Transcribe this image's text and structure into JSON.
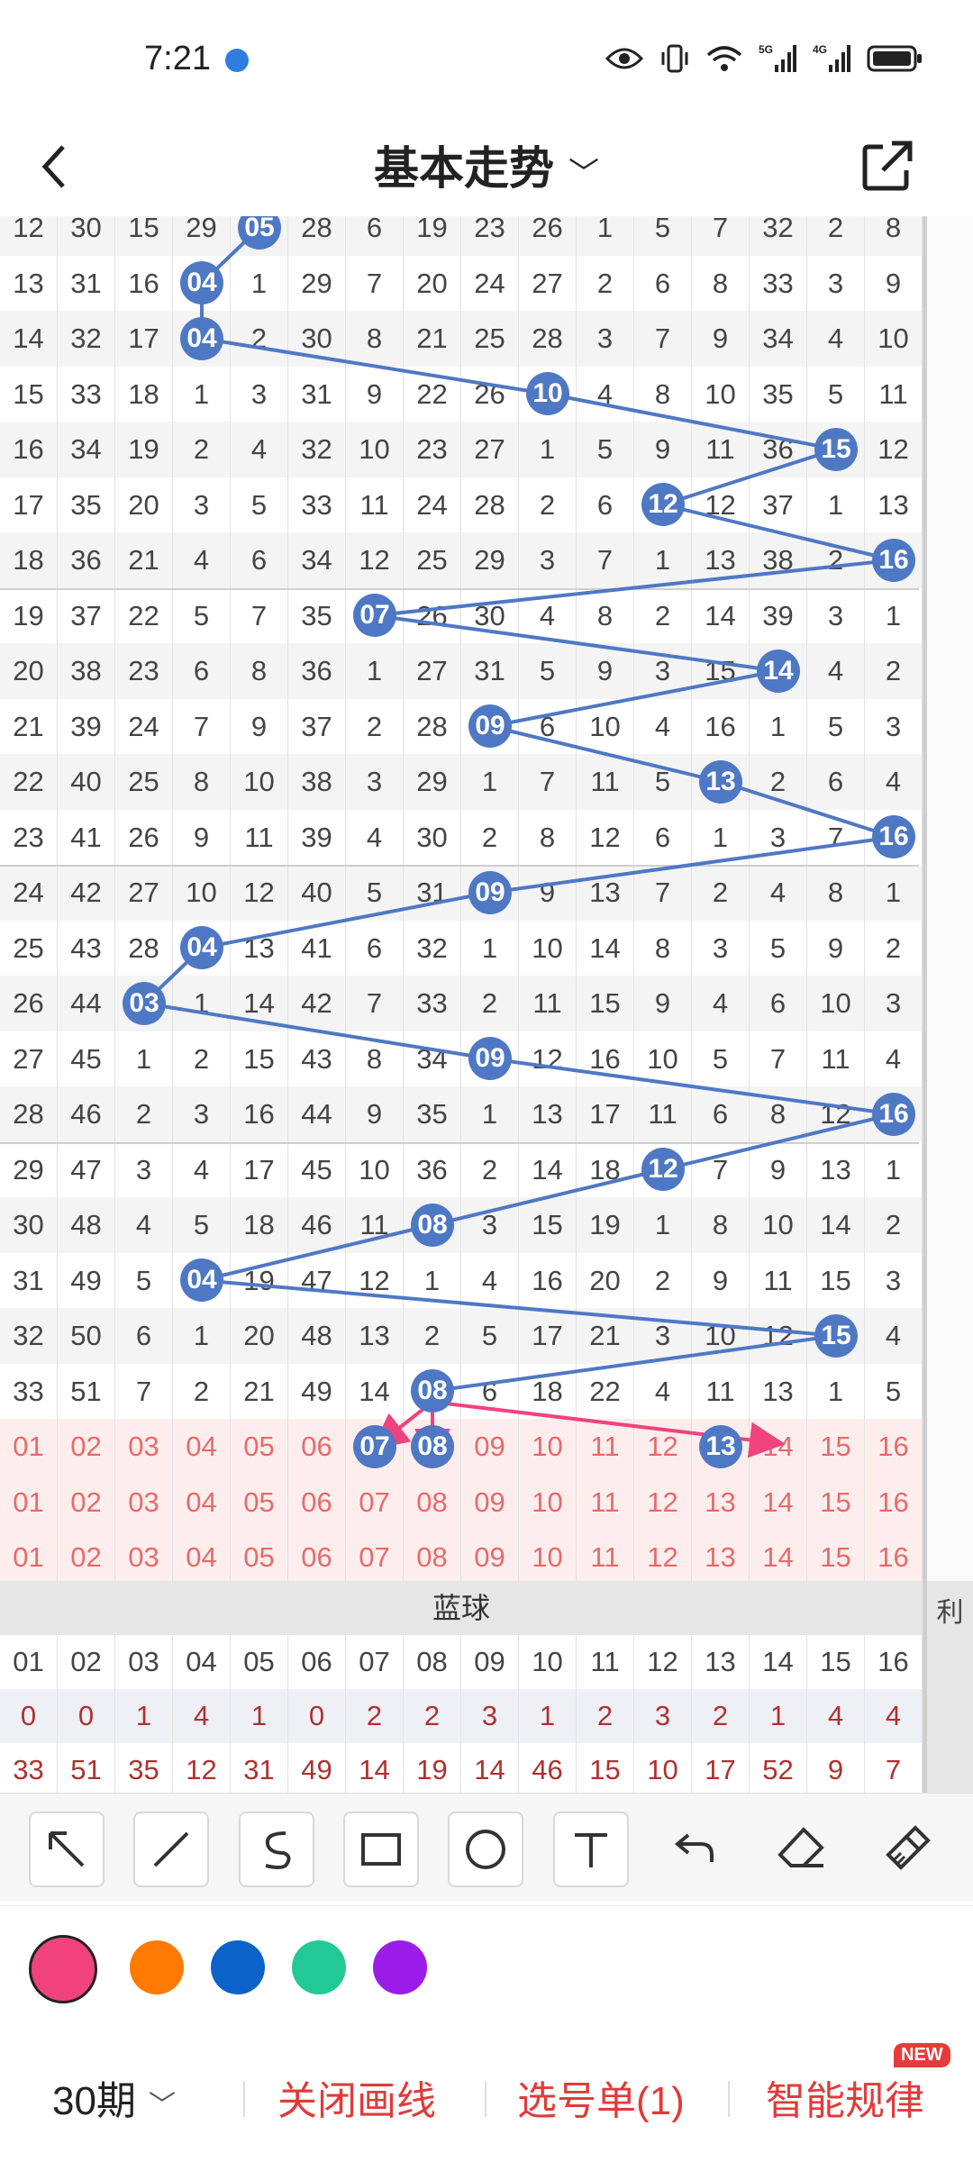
{
  "status": {
    "time": "7:21"
  },
  "header": {
    "title": "基本走势"
  },
  "grid": {
    "rows": [
      [
        "12",
        "30",
        "15",
        "29",
        "05",
        "28",
        "6",
        "19",
        "23",
        "26",
        "1",
        "5",
        "7",
        "32",
        "2",
        "8"
      ],
      [
        "13",
        "31",
        "16",
        "04",
        "1",
        "29",
        "7",
        "20",
        "24",
        "27",
        "2",
        "6",
        "8",
        "33",
        "3",
        "9"
      ],
      [
        "14",
        "32",
        "17",
        "04",
        "2",
        "30",
        "8",
        "21",
        "25",
        "28",
        "3",
        "7",
        "9",
        "34",
        "4",
        "10"
      ],
      [
        "15",
        "33",
        "18",
        "1",
        "3",
        "31",
        "9",
        "22",
        "26",
        "10",
        "4",
        "8",
        "10",
        "35",
        "5",
        "11"
      ],
      [
        "16",
        "34",
        "19",
        "2",
        "4",
        "32",
        "10",
        "23",
        "27",
        "1",
        "5",
        "9",
        "11",
        "36",
        "15",
        "12"
      ],
      [
        "17",
        "35",
        "20",
        "3",
        "5",
        "33",
        "11",
        "24",
        "28",
        "2",
        "6",
        "12",
        "12",
        "37",
        "1",
        "13"
      ],
      [
        "18",
        "36",
        "21",
        "4",
        "6",
        "34",
        "12",
        "25",
        "29",
        "3",
        "7",
        "1",
        "13",
        "38",
        "2",
        "16"
      ],
      [
        "19",
        "37",
        "22",
        "5",
        "7",
        "35",
        "07",
        "26",
        "30",
        "4",
        "8",
        "2",
        "14",
        "39",
        "3",
        "1"
      ],
      [
        "20",
        "38",
        "23",
        "6",
        "8",
        "36",
        "1",
        "27",
        "31",
        "5",
        "9",
        "3",
        "15",
        "14",
        "4",
        "2"
      ],
      [
        "21",
        "39",
        "24",
        "7",
        "9",
        "37",
        "2",
        "28",
        "09",
        "6",
        "10",
        "4",
        "16",
        "1",
        "5",
        "3"
      ],
      [
        "22",
        "40",
        "25",
        "8",
        "10",
        "38",
        "3",
        "29",
        "1",
        "7",
        "11",
        "5",
        "13",
        "2",
        "6",
        "4"
      ],
      [
        "23",
        "41",
        "26",
        "9",
        "11",
        "39",
        "4",
        "30",
        "2",
        "8",
        "12",
        "6",
        "1",
        "3",
        "7",
        "16"
      ],
      [
        "24",
        "42",
        "27",
        "10",
        "12",
        "40",
        "5",
        "31",
        "09",
        "9",
        "13",
        "7",
        "2",
        "4",
        "8",
        "1"
      ],
      [
        "25",
        "43",
        "28",
        "04",
        "13",
        "41",
        "6",
        "32",
        "1",
        "10",
        "14",
        "8",
        "3",
        "5",
        "9",
        "2"
      ],
      [
        "26",
        "44",
        "03",
        "1",
        "14",
        "42",
        "7",
        "33",
        "2",
        "11",
        "15",
        "9",
        "4",
        "6",
        "10",
        "3"
      ],
      [
        "27",
        "45",
        "1",
        "2",
        "15",
        "43",
        "8",
        "34",
        "09",
        "12",
        "16",
        "10",
        "5",
        "7",
        "11",
        "4"
      ],
      [
        "28",
        "46",
        "2",
        "3",
        "16",
        "44",
        "9",
        "35",
        "1",
        "13",
        "17",
        "11",
        "6",
        "8",
        "12",
        "16"
      ],
      [
        "29",
        "47",
        "3",
        "4",
        "17",
        "45",
        "10",
        "36",
        "2",
        "14",
        "18",
        "12",
        "7",
        "9",
        "13",
        "1"
      ],
      [
        "30",
        "48",
        "4",
        "5",
        "18",
        "46",
        "11",
        "08",
        "3",
        "15",
        "19",
        "1",
        "8",
        "10",
        "14",
        "2"
      ],
      [
        "31",
        "49",
        "5",
        "04",
        "19",
        "47",
        "12",
        "1",
        "4",
        "16",
        "20",
        "2",
        "9",
        "11",
        "15",
        "3"
      ],
      [
        "32",
        "50",
        "6",
        "1",
        "20",
        "48",
        "13",
        "2",
        "5",
        "17",
        "21",
        "3",
        "10",
        "12",
        "15",
        "4"
      ],
      [
        "33",
        "51",
        "7",
        "2",
        "21",
        "49",
        "14",
        "08",
        "6",
        "18",
        "22",
        "4",
        "11",
        "13",
        "1",
        "5"
      ]
    ],
    "pick_rows": [
      [
        "01",
        "02",
        "03",
        "04",
        "05",
        "06",
        "07",
        "08",
        "09",
        "10",
        "11",
        "12",
        "13",
        "14",
        "15",
        "16"
      ],
      [
        "01",
        "02",
        "03",
        "04",
        "05",
        "06",
        "07",
        "08",
        "09",
        "10",
        "11",
        "12",
        "13",
        "14",
        "15",
        "16"
      ],
      [
        "01",
        "02",
        "03",
        "04",
        "05",
        "06",
        "07",
        "08",
        "09",
        "10",
        "11",
        "12",
        "13",
        "14",
        "15",
        "16"
      ]
    ],
    "balls": [
      {
        "row": 0,
        "col": 4,
        "label": "05"
      },
      {
        "row": 1,
        "col": 3,
        "label": "04"
      },
      {
        "row": 2,
        "col": 3,
        "label": "04"
      },
      {
        "row": 3,
        "col": 9,
        "label": "10"
      },
      {
        "row": 4,
        "col": 14,
        "label": "15"
      },
      {
        "row": 5,
        "col": 11,
        "label": "12"
      },
      {
        "row": 6,
        "col": 15,
        "label": "16"
      },
      {
        "row": 7,
        "col": 6,
        "label": "07"
      },
      {
        "row": 8,
        "col": 13,
        "label": "14"
      },
      {
        "row": 9,
        "col": 8,
        "label": "09"
      },
      {
        "row": 10,
        "col": 12,
        "label": "13"
      },
      {
        "row": 11,
        "col": 15,
        "label": "16"
      },
      {
        "row": 12,
        "col": 8,
        "label": "09"
      },
      {
        "row": 13,
        "col": 3,
        "label": "04"
      },
      {
        "row": 14,
        "col": 2,
        "label": "03"
      },
      {
        "row": 15,
        "col": 8,
        "label": "09"
      },
      {
        "row": 16,
        "col": 15,
        "label": "16"
      },
      {
        "row": 17,
        "col": 11,
        "label": "12"
      },
      {
        "row": 18,
        "col": 7,
        "label": "08"
      },
      {
        "row": 19,
        "col": 3,
        "label": "04"
      },
      {
        "row": 20,
        "col": 14,
        "label": "15"
      },
      {
        "row": 21,
        "col": 7,
        "label": "08"
      }
    ],
    "pick_balls": [
      {
        "row": 0,
        "col": 6,
        "label": "07"
      },
      {
        "row": 0,
        "col": 7,
        "label": "08"
      },
      {
        "row": 0,
        "col": 12,
        "label": "13"
      }
    ]
  },
  "blue": {
    "header": "蓝球",
    "numbers": [
      "01",
      "02",
      "03",
      "04",
      "05",
      "06",
      "07",
      "08",
      "09",
      "10",
      "11",
      "12",
      "13",
      "14",
      "15",
      "16"
    ],
    "row1": [
      "0",
      "0",
      "1",
      "4",
      "1",
      "0",
      "2",
      "2",
      "3",
      "1",
      "2",
      "3",
      "2",
      "1",
      "4",
      "4"
    ],
    "row2": [
      "33",
      "51",
      "35",
      "12",
      "31",
      "49",
      "14",
      "19",
      "14",
      "46",
      "15",
      "10",
      "17",
      "52",
      "9",
      "7"
    ],
    "side_label": "利"
  },
  "toolbar": {
    "tools": [
      "arrow-icon",
      "line-icon",
      "curve-icon",
      "rectangle-icon",
      "circle-icon",
      "text-icon",
      "undo-icon",
      "eraser-icon",
      "clear-icon"
    ]
  },
  "colors": {
    "swatches": [
      "#f0437e",
      "#ff7a00",
      "#0b62c9",
      "#22c995",
      "#9b1ce8"
    ],
    "selected": 0
  },
  "bottom": {
    "period": "30期",
    "close_draw": "关闭画线",
    "pick_list": "选号单(1)",
    "smart": "智能规律",
    "badge": "NEW"
  }
}
